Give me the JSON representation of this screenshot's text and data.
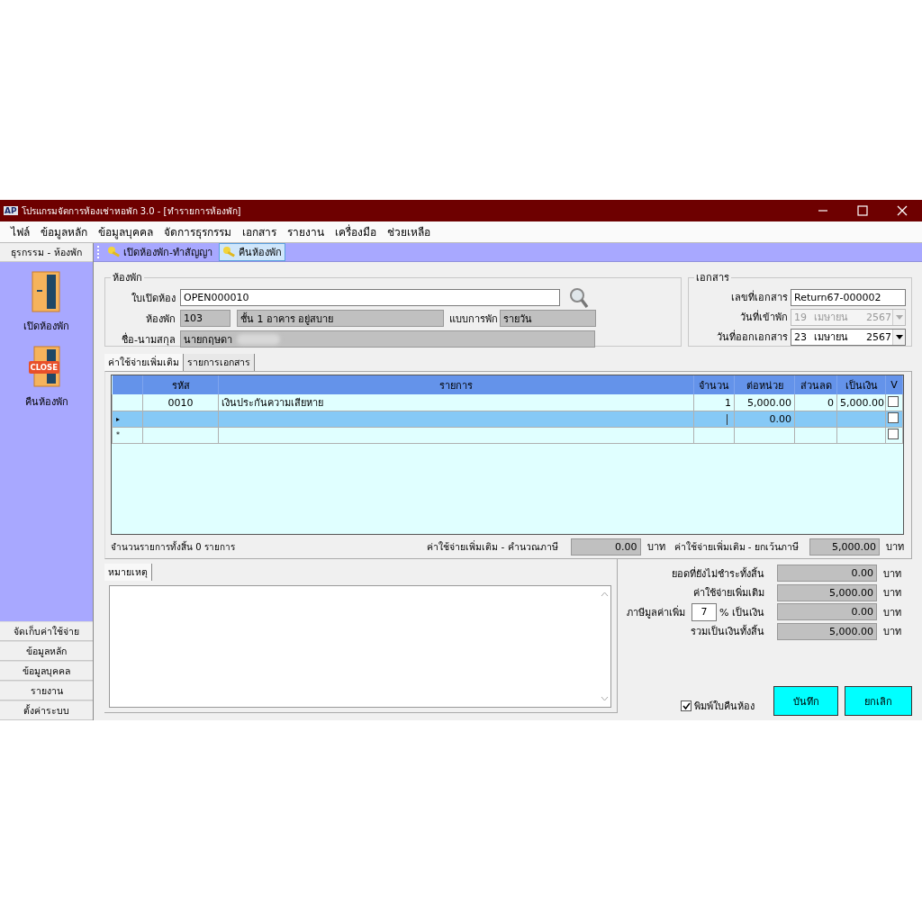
{
  "window": {
    "badge": "AP",
    "title": "โปรแกรมจัดการห้องเช่าหอพัก 3.0 - [ทำรายการห้องพัก]"
  },
  "menu": [
    "ไฟล์",
    "ข้อมูลหลัก",
    "ข้อมูลบุคคล",
    "จัดการธุรกรรม",
    "เอกสาร",
    "รายงาน",
    "เครื่องมือ",
    "ช่วยเหลือ"
  ],
  "sidebar": {
    "header": "ธุรกรรม - ห้องพัก",
    "items": [
      {
        "label": "เปิดห้องพัก",
        "kind": "open"
      },
      {
        "label": "คืนห้องพัก",
        "kind": "close",
        "badge": "CLOSE"
      }
    ],
    "sections": [
      "จัดเก็บค่าใช้จ่าย",
      "ข้อมูลหลัก",
      "ข้อมูลบุคคล",
      "รายงาน",
      "ตั้งค่าระบบ"
    ]
  },
  "toolbar": [
    {
      "label": "เปิดห้องพัก-ทำสัญญา",
      "selected": false
    },
    {
      "label": "คืนห้องพัก",
      "selected": true
    }
  ],
  "room": {
    "title": "ห้องพัก",
    "open_no": {
      "label": "ใบเปิดห้อง",
      "value": "OPEN000010"
    },
    "room": {
      "label": "ห้องพัก",
      "code": "103",
      "description": "ชั้น 1 อาคาร อยู่สบาย"
    },
    "stay_type": {
      "label": "แบบการพัก",
      "value": "รายวัน"
    },
    "name": {
      "label": "ชื่อ-นามสกุล",
      "value": "นายกฤษดา",
      "redacted": true
    }
  },
  "document": {
    "title": "เอกสาร",
    "doc_no": {
      "label": "เลขที่เอกสาร",
      "value": "Return67-000002"
    },
    "dates": [
      {
        "label": "วันที่เข้าพัก",
        "day": "19",
        "month": "เมษายน",
        "year": "2567",
        "disabled": true
      },
      {
        "label": "วันที่ออกเอกสาร",
        "day": "23",
        "month": "เมษายน",
        "year": "2567",
        "disabled": false
      }
    ]
  },
  "tabs": [
    {
      "label": "ค่าใช้จ่ายเพิ่มเติม",
      "selected": true
    },
    {
      "label": "รายการเอกสาร",
      "selected": false
    }
  ],
  "grid": {
    "columns": [
      "รหัส",
      "รายการ",
      "จำนวน",
      "ต่อหน่วย",
      "ส่วนลด",
      "เป็นเงิน",
      "V"
    ],
    "rows": [
      {
        "marker": "",
        "code": "0010",
        "item": "เงินประกันความเสียหาย",
        "qty": "1",
        "unit": "5,000.00",
        "discount": "0",
        "amount": "5,000.00",
        "checked": false,
        "selected": false,
        "editing": false
      },
      {
        "marker": "▸",
        "code": "",
        "item": "",
        "qty": "",
        "unit": "0.00",
        "discount": "",
        "amount": "",
        "checked": false,
        "selected": true,
        "editing": true
      },
      {
        "marker": "*",
        "code": "",
        "item": "",
        "qty": "",
        "unit": "",
        "discount": "",
        "amount": "",
        "checked": false,
        "selected": false,
        "editing": false
      }
    ]
  },
  "summary": {
    "count": "จำนวนรายการทั้งสิ้น  0 รายการ",
    "taxable": {
      "label": "ค่าใช้จ่ายเพิ่มเติม - คำนวณภาษี",
      "value": "0.00",
      "unit": "บาท"
    },
    "exempt": {
      "label": "ค่าใช้จ่ายเพิ่มเติม - ยกเว้นภาษี",
      "value": "5,000.00",
      "unit": "บาท"
    }
  },
  "remarks": {
    "tab": "หมายเหตุ"
  },
  "totals": [
    {
      "kind": "plain",
      "label": "ยอดที่ยังไม่ชำระทั้งสิ้น",
      "value": "0.00",
      "unit": "บาท"
    },
    {
      "kind": "plain",
      "label": "ค่าใช้จ่ายเพิ่มเติม",
      "value": "5,000.00",
      "unit": "บาท"
    },
    {
      "kind": "vat",
      "label": "ภาษีมูลค่าเพิ่ม",
      "rate": "7",
      "suffix": "% เป็นเงิน",
      "value": "0.00",
      "unit": "บาท"
    },
    {
      "kind": "plain",
      "label": "รวมเป็นเงินทั้งสิ้น",
      "value": "5,000.00",
      "unit": "บาท"
    }
  ],
  "print_option": {
    "label": "พิมพ์ใบคืนห้อง",
    "checked": true
  },
  "buttons": [
    "บันทึก",
    "ยกเลิก"
  ]
}
